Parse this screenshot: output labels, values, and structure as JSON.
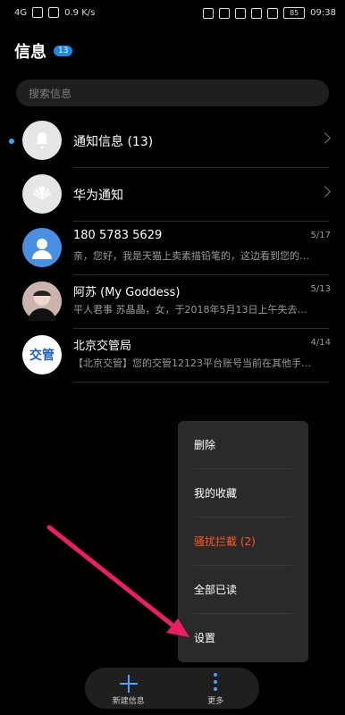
{
  "status": {
    "left": "4G",
    "speed": "0.9\nK/s",
    "battery": "85",
    "time": "09:38"
  },
  "header": {
    "title": "信息",
    "badge": "13"
  },
  "search": {
    "placeholder": "搜索信息"
  },
  "conversations": [
    {
      "name": "通知信息 (13)",
      "snippet": "",
      "date": "",
      "unread": true,
      "avatar": "bell"
    },
    {
      "name": "华为通知",
      "snippet": "",
      "date": "",
      "unread": false,
      "avatar": "huawei"
    },
    {
      "name": "180 5783 5629",
      "snippet": "亲，您好，我是天猫上卖素描铅笔的，这边看到您的…",
      "date": "5/17",
      "unread": false,
      "avatar": "person"
    },
    {
      "name": "阿苏 (My Goddess)",
      "snippet": "平人君事 苏晶晶，女，于2018年5月13日上午失去消息…",
      "date": "5/13",
      "unread": false,
      "avatar": "photo"
    },
    {
      "name": "北京交管局",
      "snippet": "【北京交管】您的交管12123平台账号当前在其他手机…",
      "date": "4/14",
      "unread": false,
      "avatar": "交管"
    }
  ],
  "menu": {
    "items": [
      {
        "label": "删除"
      },
      {
        "label": "我的收藏"
      },
      {
        "label": "骚扰拦截 (2)",
        "highlight": true
      },
      {
        "label": "全部已读"
      },
      {
        "label": "设置"
      }
    ]
  },
  "bottom": {
    "new_label": "新建信息",
    "more_label": "更多"
  },
  "colors": {
    "accent": "#29a9ff",
    "arrow": "#e91e63",
    "highlight": "#ff5722"
  }
}
